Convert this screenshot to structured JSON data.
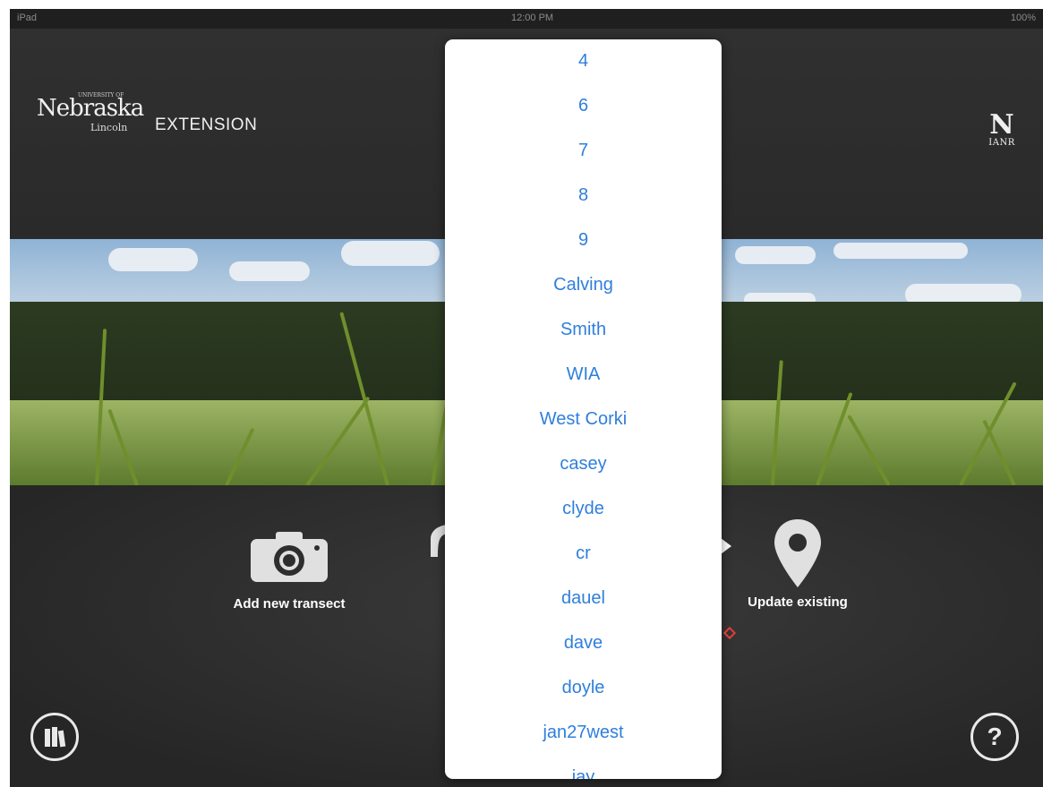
{
  "status_bar": {
    "left": "iPad",
    "center": "12:00 PM",
    "right": "100%"
  },
  "header": {
    "brand_small": "UNIVERSITY OF",
    "brand_name": "Nebraska",
    "brand_city": "Lincoln",
    "brand_unit": "EXTENSION",
    "logo_right_letter": "N",
    "logo_right_text": "IANR"
  },
  "actions": [
    {
      "label": "Add new transect",
      "icon": "camera-icon"
    },
    {
      "label": "Update existing",
      "icon": "location-pin-icon"
    }
  ],
  "footer": {
    "library_icon": "library-icon",
    "help_label": "?"
  },
  "popover": {
    "items": [
      "4",
      "6",
      "7",
      "8",
      "9",
      "Calving",
      "Smith",
      "WIA",
      "West Corki",
      "casey",
      "clyde",
      "cr",
      "dauel",
      "dave",
      "doyle",
      "jan27west",
      "jay"
    ]
  }
}
